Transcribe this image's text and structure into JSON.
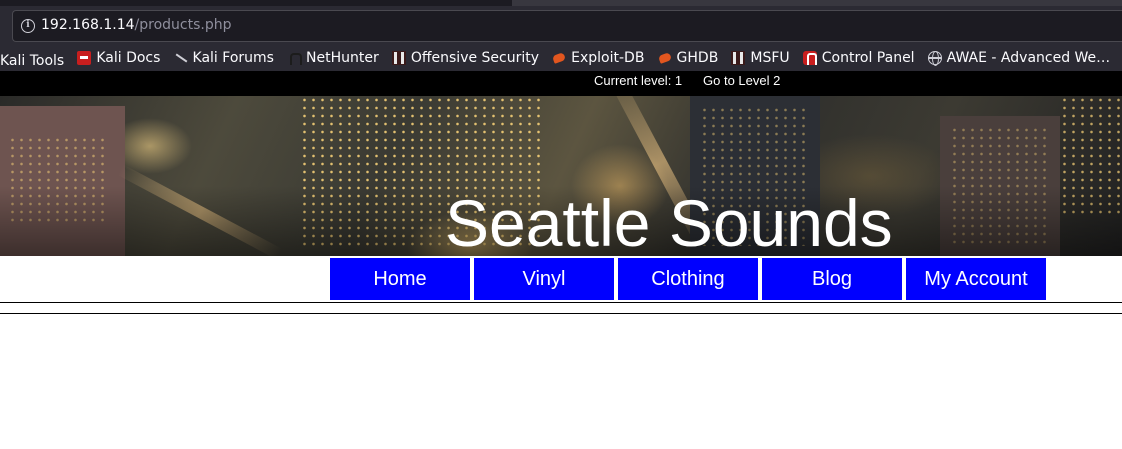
{
  "browser": {
    "url_host": "192.168.1.14",
    "url_path": "/products.php",
    "bookmarks": [
      {
        "label": "Kali Tools",
        "icon": "none"
      },
      {
        "label": "Kali Docs",
        "icon": "kali-docs-icon"
      },
      {
        "label": "Kali Forums",
        "icon": "kali-dragon-icon"
      },
      {
        "label": "NetHunter",
        "icon": "nethunter-icon"
      },
      {
        "label": "Offensive Security",
        "icon": "offsec-icon"
      },
      {
        "label": "Exploit-DB",
        "icon": "exploitdb-flame-icon"
      },
      {
        "label": "GHDB",
        "icon": "ghdb-flame-icon"
      },
      {
        "label": "MSFU",
        "icon": "msfu-icon"
      },
      {
        "label": "Control Panel",
        "icon": "control-panel-icon"
      },
      {
        "label": "AWAE - Advanced We…",
        "icon": "globe-icon"
      }
    ]
  },
  "levelbar": {
    "current_level": "Current level: 1",
    "next_level_link": "Go to Level 2"
  },
  "site": {
    "title": "Seattle Sounds",
    "nav": [
      "Home",
      "Vinyl",
      "Clothing",
      "Blog",
      "My Account"
    ]
  },
  "colors": {
    "nav_bg": "#0000ff",
    "levelbar_bg": "#000000",
    "chrome_bg": "#2b2a33"
  }
}
